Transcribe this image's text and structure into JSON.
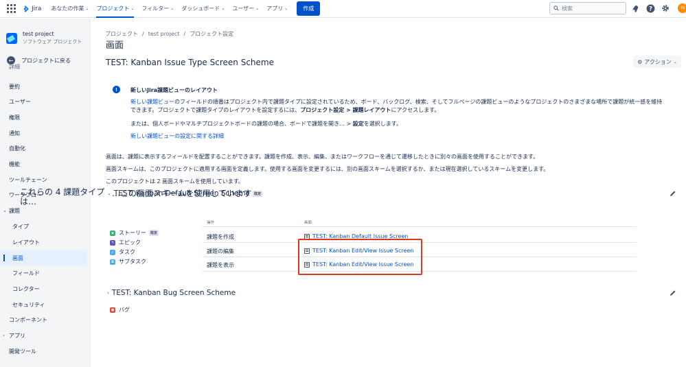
{
  "topnav": {
    "app_name": "Jira",
    "items": [
      {
        "label": "あなたの作業",
        "active": false
      },
      {
        "label": "プロジェクト",
        "active": true
      },
      {
        "label": "フィルター",
        "active": false
      },
      {
        "label": "ダッシュボード",
        "active": false
      },
      {
        "label": "ユーザー",
        "active": false
      },
      {
        "label": "アプリ",
        "active": false
      }
    ],
    "create_label": "作成",
    "search_placeholder": "検索",
    "avatar_initials": "YS"
  },
  "sidebar": {
    "project_name": "test project",
    "project_type": "ソフトウェア プロジェクト",
    "back_label": "プロジェクトに戻る",
    "partial_item": "詳細",
    "items": [
      {
        "label": "要約",
        "level": "top"
      },
      {
        "label": "ユーザー",
        "level": "top"
      },
      {
        "label": "権限",
        "level": "top"
      },
      {
        "label": "通知",
        "level": "top"
      },
      {
        "label": "自動化",
        "level": "top"
      },
      {
        "label": "機能",
        "level": "top"
      },
      {
        "label": "ツールチェーン",
        "level": "top"
      },
      {
        "label": "ワークフロー",
        "level": "top"
      },
      {
        "label": "課題",
        "level": "top",
        "expanded": true
      },
      {
        "label": "タイプ",
        "level": "sub"
      },
      {
        "label": "レイアウト",
        "level": "sub"
      },
      {
        "label": "画面",
        "level": "sub",
        "active": true
      },
      {
        "label": "フィールド",
        "level": "sub"
      },
      {
        "label": "コレクター",
        "level": "sub"
      },
      {
        "label": "セキュリティ",
        "level": "sub"
      },
      {
        "label": "コンポーネント",
        "level": "top"
      },
      {
        "label": "アプリ",
        "level": "top",
        "collapsed": true
      },
      {
        "label": "開発ツール",
        "level": "top"
      }
    ]
  },
  "main": {
    "breadcrumbs": [
      "プロジェクト",
      "test project",
      "プロジェクト設定"
    ],
    "page_title": "画面",
    "scheme_title": "TEST: Kanban Issue Type Screen Scheme",
    "action_label": "アクション",
    "notice": {
      "title": "新しいJira課題ビューのレイアウト",
      "body_link": "新しい課題ビュー",
      "body_text": "のフィールドの順番はプロジェクト内で課題タイプに設定されているため、ボード、バックログ、検索、そしてフルページの課題ビューのようなプロジェクトのさまざまな場所で課題が統一感を維持できます。プロジェクトで課題タイプのレイアウトを設定するには、",
      "body_bold": "プロジェクト設定 > 課題レイアウト",
      "body_end": "にアクセスします。",
      "line2_text": "または、個人ボードやマルチプロジェクトボードの課題の場合、ボードで課題を開き… > ",
      "line2_bold": "設定",
      "line2_end": "を選択します。",
      "link": "新しい課題ビューの設定に関する詳細"
    },
    "para1": "画面は、課題に表示するフィールドを配置することができます。課題を作成、表示、編集、またはワークフローを通じて遷移したときに別々の画面を使用することができます。",
    "para2": "画面スキームは、このプロジェクトに適用する画面を定義します。使用する画面を変更するには、別の画面スキームを選択するか、または現在選択しているスキームを変更します。",
    "para3": "このプロジェクトは 2 画面スキームを使用しています。",
    "schemes": [
      {
        "title": "TEST: Kanban Default Screen Scheme",
        "badge": "既定",
        "types_heading": "これらの 4 課題タイプは…",
        "using_heading": "…この画面スキームを使用しています",
        "issue_types": [
          {
            "name": "ストーリー",
            "badge": "既定",
            "color": "#36b37e",
            "icon": "story-icon"
          },
          {
            "name": "エピック",
            "badge": "",
            "color": "#6554c0",
            "icon": "epic-icon"
          },
          {
            "name": "タスク",
            "badge": "",
            "color": "#4bade8",
            "icon": "task-icon"
          },
          {
            "name": "サブタスク",
            "badge": "",
            "color": "#4bade8",
            "icon": "subtask-icon"
          }
        ],
        "col_operation": "操作",
        "col_screen": "画面",
        "operations": [
          {
            "op": "課題を作成",
            "screen": "TEST: Kanban Default Issue Screen"
          },
          {
            "op": "課題の編集",
            "screen": "TEST: Kanban Edit/View Issue Screen"
          },
          {
            "op": "課題を表示",
            "screen": "TEST: Kanban Edit/View Issue Screen"
          }
        ]
      },
      {
        "title": "TEST: Kanban Bug Screen Scheme",
        "issue_types": [
          {
            "name": "バグ",
            "color": "#e5493a",
            "icon": "bug-icon"
          }
        ]
      }
    ]
  },
  "colors": {
    "accent": "#0052cc",
    "highlight_border": "#e5341a"
  }
}
